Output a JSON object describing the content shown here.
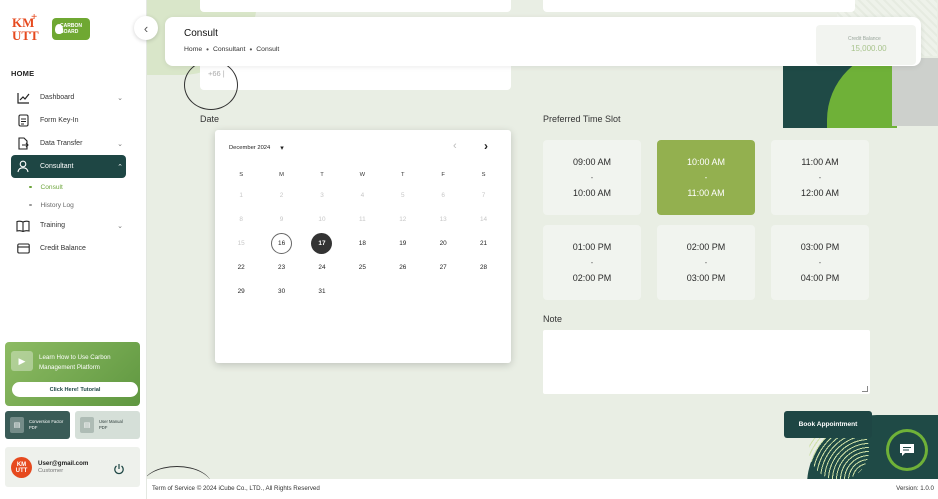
{
  "sidebar": {
    "logo_text_top": "KM",
    "logo_text_bottom": "UTT",
    "brand_badge": "CARBON BOARD",
    "section_label": "HOME",
    "items": [
      {
        "label": "Dashboard",
        "icon": "chart-line-icon",
        "has_chevron": true
      },
      {
        "label": "Form Key-In",
        "icon": "document-icon",
        "has_chevron": false
      },
      {
        "label": "Data Transfer",
        "icon": "file-transfer-icon",
        "has_chevron": true
      },
      {
        "label": "Consultant",
        "icon": "person-icon",
        "has_chevron": true,
        "active": true
      },
      {
        "label": "Training",
        "icon": "book-icon",
        "has_chevron": true
      },
      {
        "label": "Credit Balance",
        "icon": "credit-card-icon",
        "has_chevron": false
      }
    ],
    "consultant_sub": [
      {
        "label": "Consult",
        "active": true
      },
      {
        "label": "History Log",
        "active": false
      }
    ],
    "tutorial": {
      "text": "Learn How to Use Carbon Management Platform",
      "button": "Click Here! Tutorial"
    },
    "docs": [
      {
        "title": "Conversion Factor",
        "type": "PDF"
      },
      {
        "title": "User Manual",
        "type": "PDF"
      }
    ],
    "user": {
      "avatar_text_top": "KM",
      "avatar_text_bottom": "UTT",
      "email": "User@gmail.com",
      "role": "Customer"
    }
  },
  "header": {
    "title": "Consult",
    "breadcrumb": [
      "Home",
      "Consultant",
      "Consult"
    ],
    "credit_label": "Credit Balance",
    "credit_value": "15,000.00"
  },
  "form": {
    "phone_value": "+66 |",
    "date_label": "Date",
    "time_label": "Preferred Time Slot",
    "note_label": "Note",
    "note_value": "",
    "book_button": "Book Appointment"
  },
  "calendar": {
    "month_label": "December 2024",
    "weekdays": [
      "S",
      "M",
      "T",
      "W",
      "T",
      "F",
      "S"
    ],
    "days": [
      {
        "d": "1",
        "disabled": true
      },
      {
        "d": "2",
        "disabled": true
      },
      {
        "d": "3",
        "disabled": true
      },
      {
        "d": "4",
        "disabled": true
      },
      {
        "d": "5",
        "disabled": true
      },
      {
        "d": "6",
        "disabled": true
      },
      {
        "d": "7",
        "disabled": true
      },
      {
        "d": "8",
        "disabled": true
      },
      {
        "d": "9",
        "disabled": true
      },
      {
        "d": "10",
        "disabled": true
      },
      {
        "d": "11",
        "disabled": true
      },
      {
        "d": "12",
        "disabled": true
      },
      {
        "d": "13",
        "disabled": true
      },
      {
        "d": "14",
        "disabled": true
      },
      {
        "d": "15",
        "disabled": true
      },
      {
        "d": "16",
        "today": true
      },
      {
        "d": "17",
        "selected": true
      },
      {
        "d": "18"
      },
      {
        "d": "19"
      },
      {
        "d": "20"
      },
      {
        "d": "21"
      },
      {
        "d": "22"
      },
      {
        "d": "23"
      },
      {
        "d": "24"
      },
      {
        "d": "25"
      },
      {
        "d": "26"
      },
      {
        "d": "27"
      },
      {
        "d": "28"
      },
      {
        "d": "29"
      },
      {
        "d": "30"
      },
      {
        "d": "31"
      }
    ]
  },
  "slots": [
    {
      "start": "09:00 AM",
      "dash": "-",
      "end": "10:00 AM",
      "selected": false
    },
    {
      "start": "10:00 AM",
      "dash": "-",
      "end": "11:00 AM",
      "selected": true
    },
    {
      "start": "11:00 AM",
      "dash": "-",
      "end": "12:00 AM",
      "selected": false
    },
    {
      "start": "01:00 PM",
      "dash": "-",
      "end": "02:00 PM",
      "selected": false
    },
    {
      "start": "02:00 PM",
      "dash": "-",
      "end": "03:00 PM",
      "selected": false
    },
    {
      "start": "03:00 PM",
      "dash": "-",
      "end": "04:00 PM",
      "selected": false
    }
  ],
  "footer": {
    "left": "Term of Service © 2024 iCube Co., LTD., All Rights Reserved",
    "right": "Version: 1.0.0"
  },
  "colors": {
    "primary_dark": "#1e4644",
    "accent_green": "#93b04f",
    "brand_orange": "#e64a1f"
  }
}
